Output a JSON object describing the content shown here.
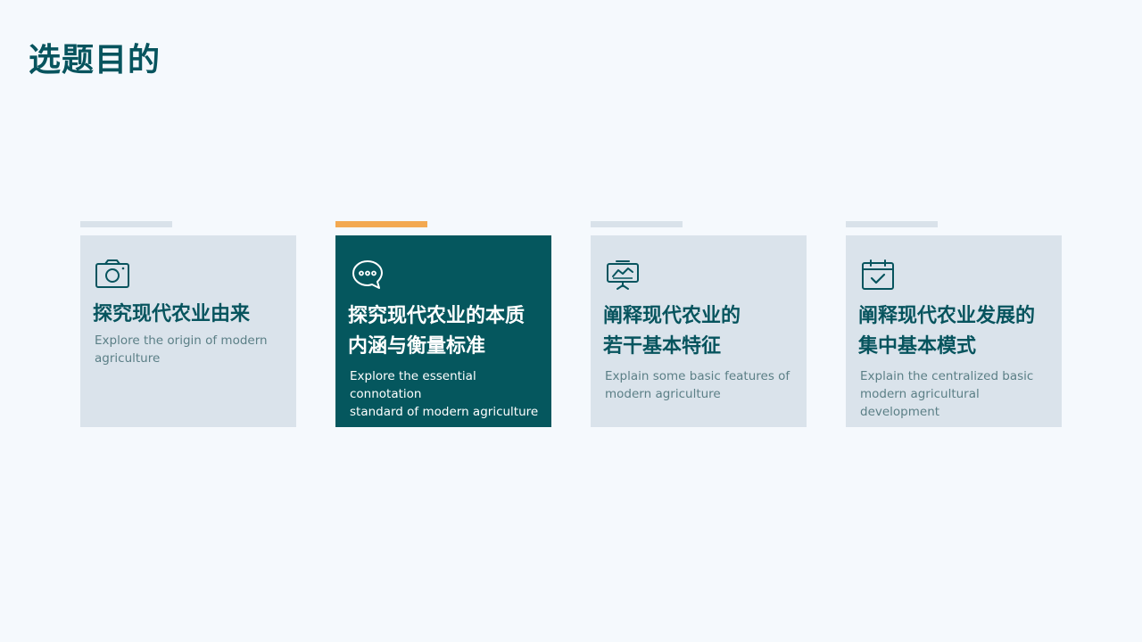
{
  "slide": {
    "title": "选题目的"
  },
  "cards": [
    {
      "icon": "camera-icon",
      "title_line1": "探究现代农业由来",
      "title_line2": "",
      "desc_line1": "Explore the origin of modern",
      "desc_line2": "agriculture"
    },
    {
      "icon": "chat-bubbles-icon",
      "title_line1": "探究现代农业的本质",
      "title_line2": "内涵与衡量标准",
      "desc_line1": "Explore the essential connotation",
      "desc_line2": "standard of modern agriculture"
    },
    {
      "icon": "presentation-chart-icon",
      "title_line1": "阐释现代农业的",
      "title_line2": "若干基本特征",
      "desc_line1": "Explain some basic features of",
      "desc_line2": "modern agriculture"
    },
    {
      "icon": "calendar-check-icon",
      "title_line1": "阐释现代农业发展的",
      "title_line2": "集中基本模式",
      "desc_line1": "Explain the centralized basic",
      "desc_line2": "modern agricultural development"
    }
  ],
  "colors": {
    "background": "#f5f9fd",
    "primary": "#07545e",
    "card": "#dae3eb",
    "active_card": "#05575e",
    "accent_tab": "#f3a950",
    "muted_text": "#5b7f86"
  }
}
